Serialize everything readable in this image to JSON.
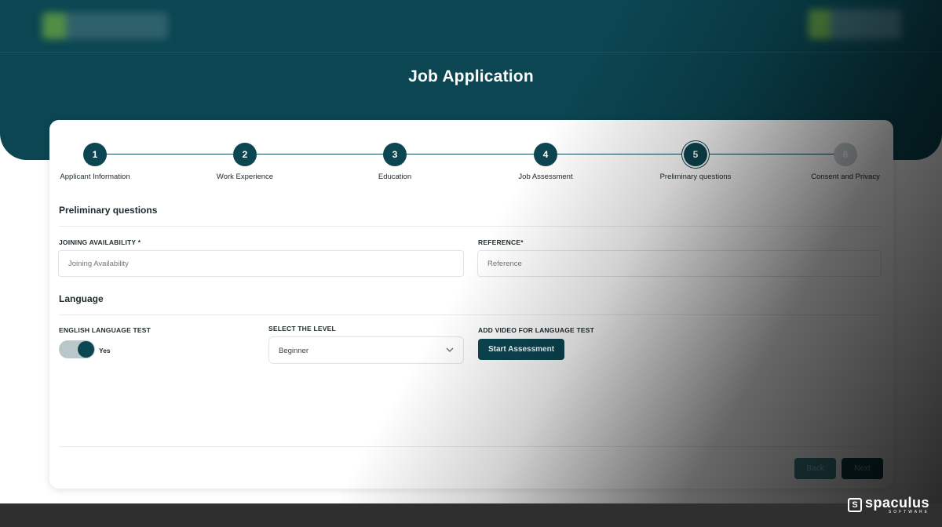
{
  "page": {
    "title": "Job Application"
  },
  "stepper": {
    "steps": [
      {
        "number": "1",
        "label": "Applicant Information",
        "status": "completed"
      },
      {
        "number": "2",
        "label": "Work Experience",
        "status": "completed"
      },
      {
        "number": "3",
        "label": "Education",
        "status": "completed"
      },
      {
        "number": "4",
        "label": "Job Assessment",
        "status": "completed"
      },
      {
        "number": "5",
        "label": "Preliminary questions",
        "status": "active"
      },
      {
        "number": "6",
        "label": "Consent and Privacy",
        "status": "pending"
      }
    ]
  },
  "preliminary": {
    "section_title": "Preliminary questions",
    "joining": {
      "label": "JOINING AVAILABILITY *",
      "placeholder": "Joining Availability"
    },
    "reference": {
      "label": "REFERENCE*",
      "placeholder": "Reference"
    }
  },
  "language": {
    "section_title": "Language",
    "english_test": {
      "label": "ENGLISH LANGUAGE TEST",
      "toggle_on": true,
      "toggle_text": "Yes"
    },
    "level": {
      "label": "SELECT THE LEVEL",
      "value": "Beginner"
    },
    "video": {
      "label": "ADD VIDEO FOR LANGUAGE TEST",
      "button": "Start Assessment"
    }
  },
  "footer": {
    "back_label": "Back",
    "next_label": "Next"
  },
  "brand": {
    "name": "spaculus",
    "tagline": "SOFTWARE"
  },
  "colors": {
    "primary": "#0b4652",
    "pending": "#c7d0d2",
    "border": "#dfe5e6"
  }
}
